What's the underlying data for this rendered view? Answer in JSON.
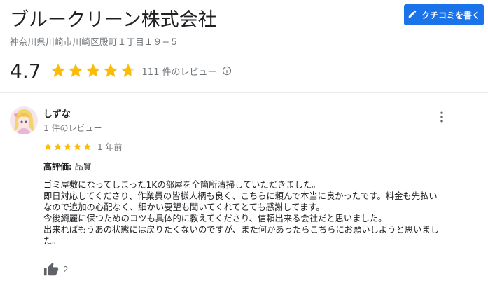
{
  "business": {
    "name": "ブルークリーン株式会社",
    "address": "神奈川県川崎市川崎区殿町１丁目１９−５",
    "rating": "4.7",
    "rating_value": 4.7,
    "review_count": "111 件のレビュー"
  },
  "actions": {
    "write_review_label": "クチコミを書く"
  },
  "colors": {
    "accent": "#1a73e8",
    "star": "#fbbc04",
    "star_empty": "#dadce0"
  },
  "review": {
    "author": "しずな",
    "author_meta": "1 件のレビュー",
    "stars": 5,
    "time": "1 年前",
    "highlight_label": "高評価:",
    "highlight_value": "品質",
    "text_lines": [
      "ゴミ屋敷になってしまった1Kの部屋を全箇所清掃していただきました。",
      "即日対応してくださり、作業員の皆様人柄も良く、こちらに頼んで本当に良かったです。料金も先払い",
      "なので追加の心配なく、細かい要望も聞いてくれてとても感謝してます。",
      "今後綺麗に保つためのコツも具体的に教えてくださり、信頼出来る会社だと思いました。",
      "出来ればもうあの状態には戻りたくないのですが、また何かあったらこちらにお願いしようと思いまし",
      "た。"
    ],
    "likes": "2"
  },
  "icons": {
    "pencil": "pencil-icon",
    "info": "info-icon",
    "more": "more-vert-icon",
    "like": "thumb-up-icon",
    "star": "star-icon"
  }
}
